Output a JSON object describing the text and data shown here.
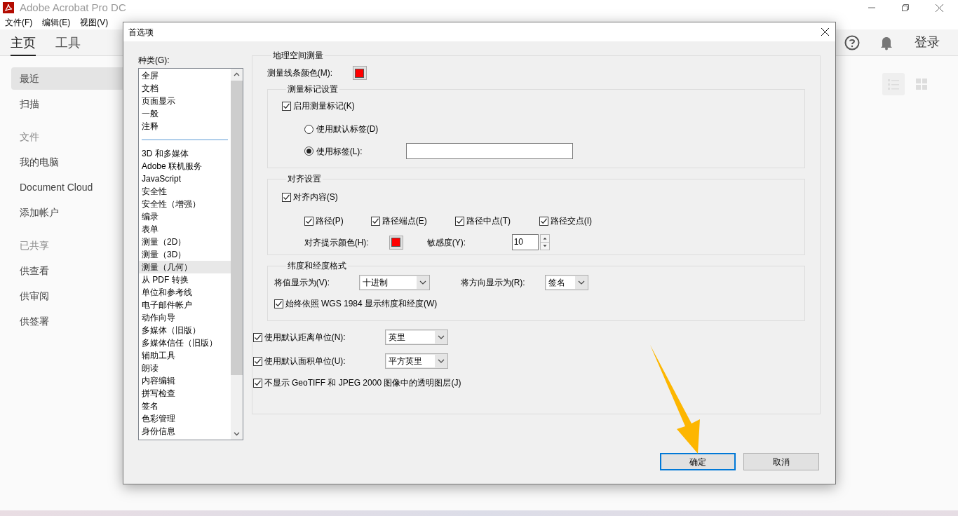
{
  "window": {
    "title": "Adobe Acrobat Pro DC"
  },
  "menu": [
    "文件(F)",
    "编辑(E)",
    "视图(V)"
  ],
  "nav_tabs": [
    {
      "label": "主页",
      "selected": true
    },
    {
      "label": "工具",
      "selected": false
    }
  ],
  "login": "登录",
  "sidebar": [
    {
      "kind": "item",
      "label": "最近",
      "selected": true
    },
    {
      "kind": "item",
      "label": "扫描",
      "selected": false
    },
    {
      "kind": "header",
      "label": "文件",
      "selected": false
    },
    {
      "kind": "item",
      "label": "我的电脑",
      "selected": false
    },
    {
      "kind": "item",
      "label": "Document Cloud",
      "selected": false
    },
    {
      "kind": "item",
      "label": "添加帐户",
      "selected": false
    },
    {
      "kind": "header",
      "label": "已共享",
      "selected": false
    },
    {
      "kind": "item",
      "label": "供查看",
      "selected": false
    },
    {
      "kind": "item",
      "label": "供审阅",
      "selected": false
    },
    {
      "kind": "item",
      "label": "供签署",
      "selected": false
    }
  ],
  "dialog": {
    "title": "首选项",
    "category_label": "种类(G):",
    "category_groups": [
      [
        {
          "label": "全屏",
          "selected": false
        },
        {
          "label": "文档",
          "selected": false
        },
        {
          "label": "页面显示",
          "selected": false
        },
        {
          "label": "一般",
          "selected": false
        },
        {
          "label": "注释",
          "selected": false
        }
      ],
      [
        {
          "label": "3D 和多媒体",
          "selected": false
        },
        {
          "label": "Adobe 联机服务",
          "selected": false
        },
        {
          "label": "JavaScript",
          "selected": false
        },
        {
          "label": "安全性",
          "selected": false
        },
        {
          "label": "安全性（增强）",
          "selected": false
        },
        {
          "label": "编录",
          "selected": false
        },
        {
          "label": "表单",
          "selected": false
        },
        {
          "label": "测量（2D）",
          "selected": false
        },
        {
          "label": "测量（3D）",
          "selected": false
        },
        {
          "label": "测量（几何）",
          "selected": true
        },
        {
          "label": "从 PDF 转换",
          "selected": false
        },
        {
          "label": "单位和参考线",
          "selected": false
        },
        {
          "label": "电子邮件帐户",
          "selected": false
        },
        {
          "label": "动作向导",
          "selected": false
        },
        {
          "label": "多媒体（旧版）",
          "selected": false
        },
        {
          "label": "多媒体信任（旧版）",
          "selected": false
        },
        {
          "label": "辅助工具",
          "selected": false
        },
        {
          "label": "朗读",
          "selected": false
        },
        {
          "label": "内容编辑",
          "selected": false
        },
        {
          "label": "拼写检查",
          "selected": false
        },
        {
          "label": "签名",
          "selected": false
        },
        {
          "label": "色彩管理",
          "selected": false
        },
        {
          "label": "身份信息",
          "selected": false
        }
      ]
    ],
    "panel": {
      "title": "地理空间测量",
      "line_color": {
        "label": "测量线条颜色(M):",
        "color": "#ff0000"
      },
      "markers": {
        "title": "测量标记设置",
        "enable": {
          "label": "启用测量标记(K)",
          "checked": true
        },
        "radios": [
          {
            "label": "使用默认标签(D)",
            "selected": false
          },
          {
            "label": "使用标签(L):",
            "selected": true
          }
        ]
      },
      "snap": {
        "title": "对齐设置",
        "enable": {
          "label": "对齐内容(S)",
          "checked": true
        },
        "options": [
          {
            "label": "路径(P)",
            "checked": true
          },
          {
            "label": "路径端点(E)",
            "checked": true
          },
          {
            "label": "路径中点(T)",
            "checked": true
          },
          {
            "label": "路径交点(I)",
            "checked": true
          }
        ],
        "hint_color": {
          "label": "对齐提示颜色(H):",
          "color": "#ff0000"
        },
        "sensitivity": {
          "label": "敏感度(Y):",
          "value": "10"
        }
      },
      "latlong": {
        "title": "纬度和经度格式",
        "value_display": {
          "label": "将值显示为(V):",
          "value": "十进制"
        },
        "direction_display": {
          "label": "将方向显示为(R):",
          "value": "签名"
        },
        "wgs": {
          "label": "始终依照 WGS 1984 显示纬度和经度(W)",
          "checked": true
        }
      },
      "units": [
        {
          "label": "使用默认距离单位(N):",
          "checked": true,
          "value": "英里"
        },
        {
          "label": "使用默认面积单位(U):",
          "checked": true,
          "value": "平方英里"
        }
      ],
      "geotiff": {
        "label": "不显示 GeoTIFF 和 JPEG 2000 图像中的透明图层(J)",
        "checked": true
      }
    },
    "buttons": [
      {
        "label": "确定",
        "primary": true
      },
      {
        "label": "取消",
        "primary": false
      }
    ]
  }
}
